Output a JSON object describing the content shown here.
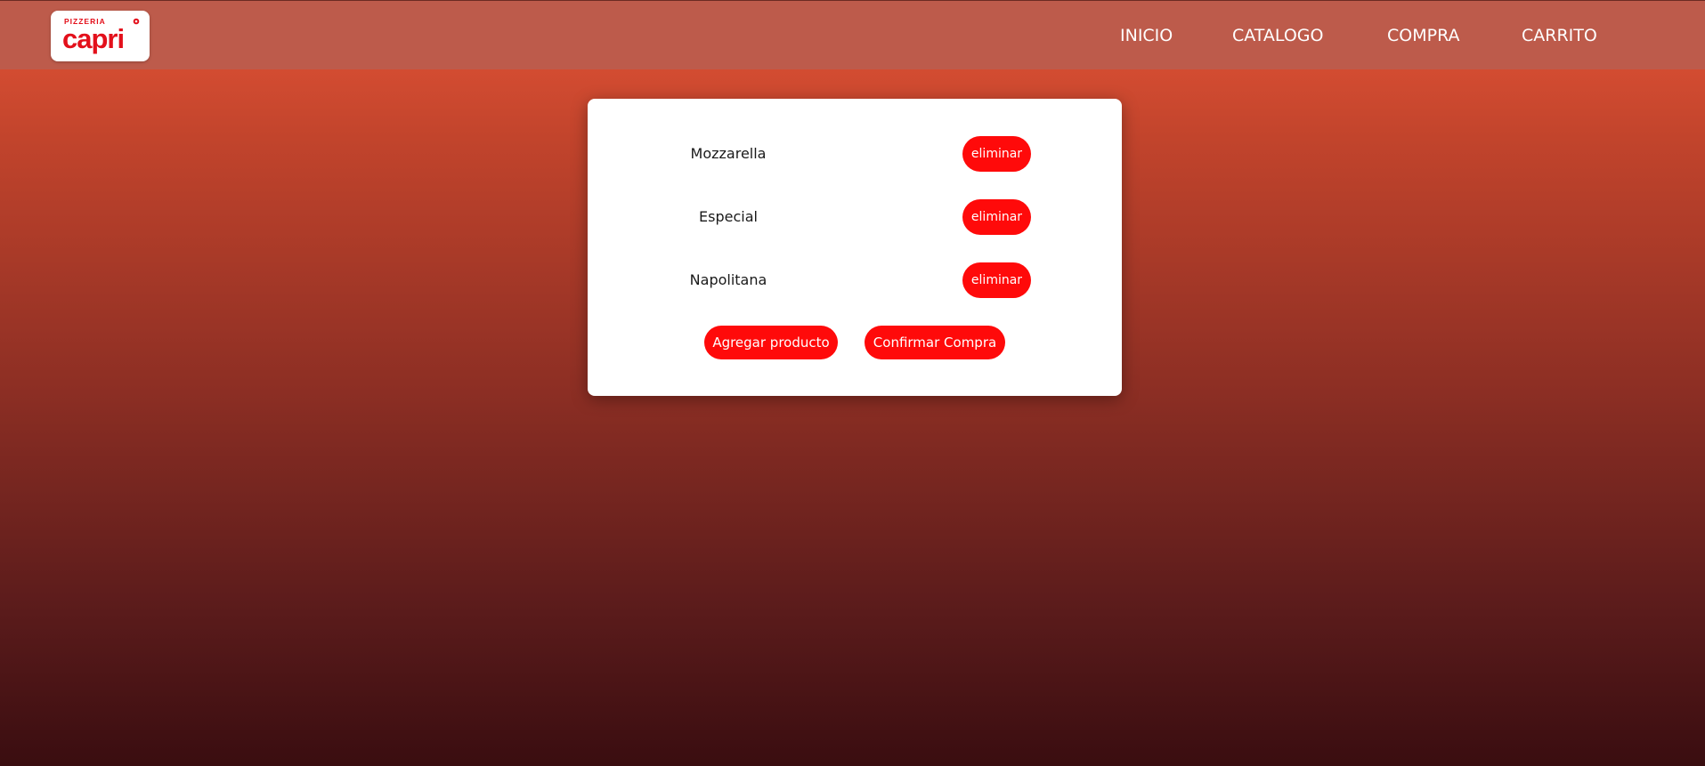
{
  "logo": {
    "top_text": "PIZZERIA",
    "brand_text": "capri",
    "brand_color": "#e3101b"
  },
  "nav": {
    "items": [
      {
        "label": "INICIO"
      },
      {
        "label": "CATALOGO"
      },
      {
        "label": "COMPRA"
      },
      {
        "label": "CARRITO"
      }
    ]
  },
  "cart": {
    "items": [
      {
        "name": "Mozzarella",
        "remove_label": "eliminar"
      },
      {
        "name": "Especial",
        "remove_label": "eliminar"
      },
      {
        "name": "Napolitana",
        "remove_label": "eliminar"
      }
    ],
    "add_label": "Agregar producto",
    "confirm_label": "Confirmar Compra"
  },
  "colors": {
    "navbar": "#bd5b4b",
    "button": "#ff0a0a",
    "gradient_top": "#e45437",
    "gradient_bottom": "#3a0d10"
  }
}
